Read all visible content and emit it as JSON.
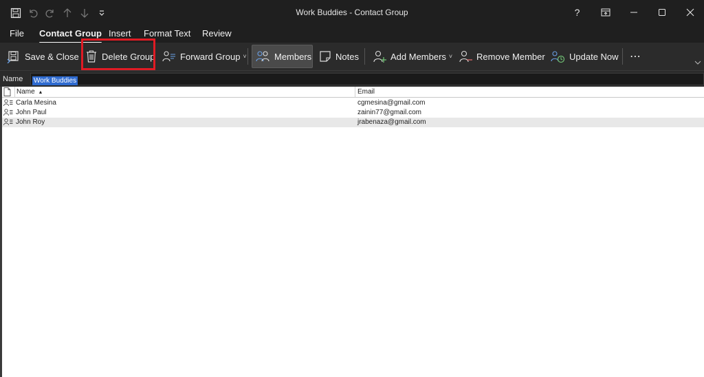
{
  "window": {
    "title": "Work Buddies  -  Contact Group",
    "quick_access_icons": [
      "save-icon",
      "undo-icon",
      "redo-icon",
      "up-arrow-icon",
      "down-arrow-icon",
      "customize-quick-access-icon"
    ],
    "controls": {
      "help": "?",
      "restore_ribbon": "restore-ribbon-icon",
      "minimize": "minimize-icon",
      "maximize": "maximize-icon",
      "close": "close-icon"
    }
  },
  "menu": {
    "tabs": [
      {
        "label": "File",
        "active": false
      },
      {
        "label": "Contact Group",
        "active": true
      },
      {
        "label": "Insert",
        "active": false
      },
      {
        "label": "Format Text",
        "active": false
      },
      {
        "label": "Review",
        "active": false
      }
    ]
  },
  "ribbon": {
    "save_close": "Save & Close",
    "delete_group": "Delete Group",
    "forward_group": "Forward Group",
    "members": "Members",
    "notes": "Notes",
    "add_members": "Add Members",
    "remove_member": "Remove Member",
    "update_now": "Update Now",
    "more": "⋯",
    "caret": "˅"
  },
  "name_field": {
    "label": "Name",
    "value": "Work Buddies"
  },
  "members_list": {
    "columns": {
      "name": "Name",
      "email": "Email",
      "sort_indicator": "▲"
    },
    "rows": [
      {
        "name": "Carla Mesina",
        "email": "cgmesina@gmail.com"
      },
      {
        "name": "John Paul",
        "email": "zainin77@gmail.com"
      },
      {
        "name": "John Roy",
        "email": "jrabenaza@gmail.com"
      }
    ]
  },
  "colors": {
    "titlebar": "#1f1f1f",
    "ribbon": "#2b2b2b",
    "highlight": "#e01b24",
    "selection": "#2f6bd0"
  }
}
